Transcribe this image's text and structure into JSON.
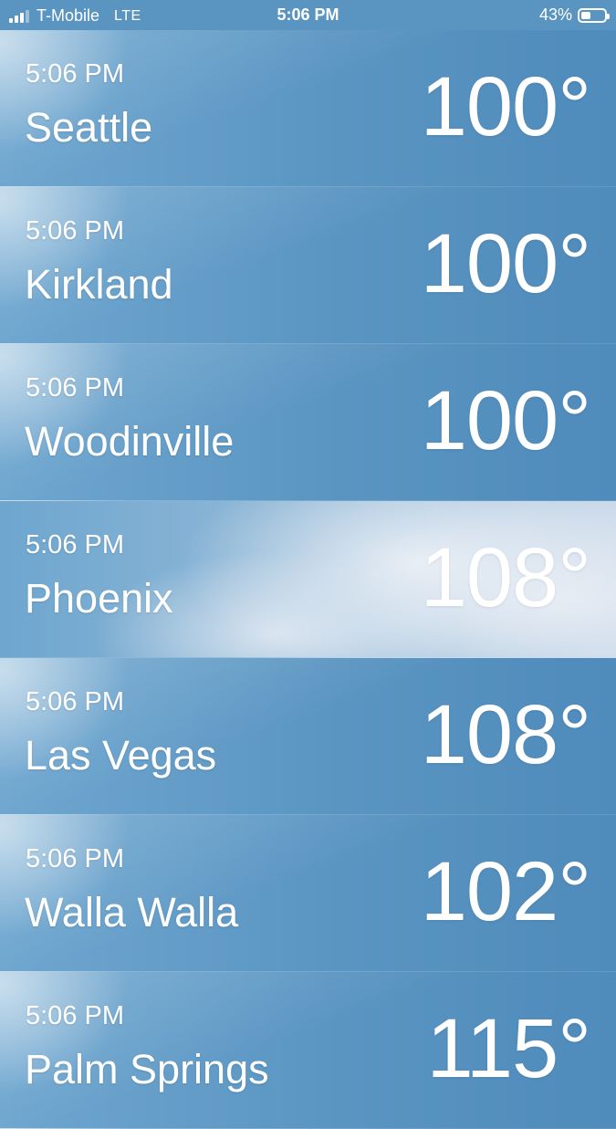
{
  "status_bar": {
    "carrier": "T-Mobile",
    "network": "LTE",
    "time": "5:06 PM",
    "battery_percent": "43%",
    "battery_level": 0.43,
    "signal_bars": 3
  },
  "cities": [
    {
      "time": "5:06 PM",
      "name": "Seattle",
      "temp": "100°"
    },
    {
      "time": "5:06 PM",
      "name": "Kirkland",
      "temp": "100°"
    },
    {
      "time": "5:06 PM",
      "name": "Woodinville",
      "temp": "100°"
    },
    {
      "time": "5:06 PM",
      "name": "Phoenix",
      "temp": "108°"
    },
    {
      "time": "5:06 PM",
      "name": "Las Vegas",
      "temp": "108°"
    },
    {
      "time": "5:06 PM",
      "name": "Walla Walla",
      "temp": "102°"
    },
    {
      "time": "5:06 PM",
      "name": "Palm Springs",
      "temp": "115°"
    }
  ],
  "colors": {
    "sky_blue": "#5a95c2",
    "cloud_white": "#e6ecf4",
    "text": "#ffffff"
  }
}
